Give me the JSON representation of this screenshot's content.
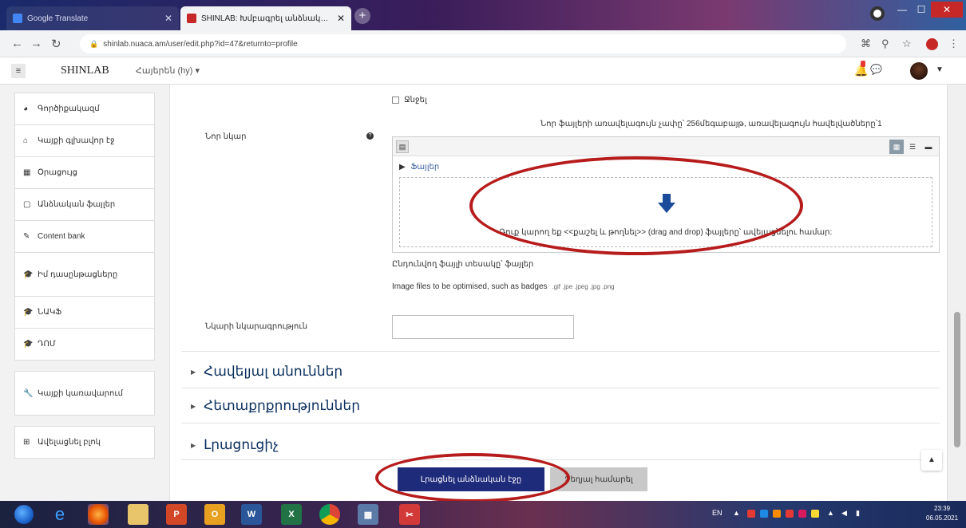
{
  "browser": {
    "tabs": [
      {
        "title": "Google Translate",
        "active": false
      },
      {
        "title": "SHINLAB: Խմբագրել անձնական պրոֆիլը",
        "active": true
      }
    ],
    "url": "shinlab.nuaca.am/user/edit.php?id=47&returnto=profile"
  },
  "navbar": {
    "site_name": "SHINLAB",
    "language": "Հայերեն (hy) ▾"
  },
  "sidebar": {
    "items": [
      {
        "label": "Գործիքակազմ",
        "icon": "dashboard-icon"
      },
      {
        "label": "Կայքի գլխավոր էջ",
        "icon": "home-icon"
      },
      {
        "label": "Օրացույց",
        "icon": "calendar-icon"
      },
      {
        "label": "Անձնական ֆայլեր",
        "icon": "file-icon"
      },
      {
        "label": "Content bank",
        "icon": "pencil-icon"
      },
      {
        "label": "Իմ դասընթացները",
        "icon": "graduation-cap-icon"
      },
      {
        "label": "ՆԱԿՖ",
        "icon": "graduation-cap-icon"
      },
      {
        "label": "ԴՈՄ",
        "icon": "graduation-cap-icon"
      },
      {
        "label": "Կայքի կառավարում",
        "icon": "wrench-icon"
      },
      {
        "label": "Ավելացնել բլոկ",
        "icon": "plus-square-icon"
      }
    ]
  },
  "form": {
    "delete_checkbox_label": "Ջնջել",
    "new_picture_label": "Նոր նկար",
    "max_size_text": "Նոր ֆայլերի առավելագույն չափը՝ 256մեգաբայթ, առավելագույն հավելվածները՝1",
    "folder_label": "Ֆայլեր",
    "drop_text": "Դուք կարող եք <<քաշել և թողնել>> (drag and drop) ֆայլերը՝ ավելացնելու համար:",
    "accepted_types": "Ընդունվող ֆայլի տեսակը՝ ֆայլեր",
    "optimised_text": "Image files to be optimised, such as badges",
    "optimised_exts": ".gif .jpe .jpeg .jpg .png",
    "picture_description_label": "Նկարի նկարագրություն",
    "picture_description_value": "",
    "sections": [
      "Հավելյալ անուններ",
      "Հետաքրքրություններ",
      "Լրացուցիչ"
    ],
    "submit_label": "Լրացնել անձնական էջը",
    "cancel_label": "Չեղյալ համարել"
  },
  "taskbar": {
    "tray_lang": "EN",
    "time": "23:39",
    "date": "06.05.2021"
  },
  "colors": {
    "primary_button": "#1e2a7a",
    "section_heading": "#0b2f5e",
    "annotation": "#b71c1c",
    "drop_arrow": "#1a4a9a"
  }
}
